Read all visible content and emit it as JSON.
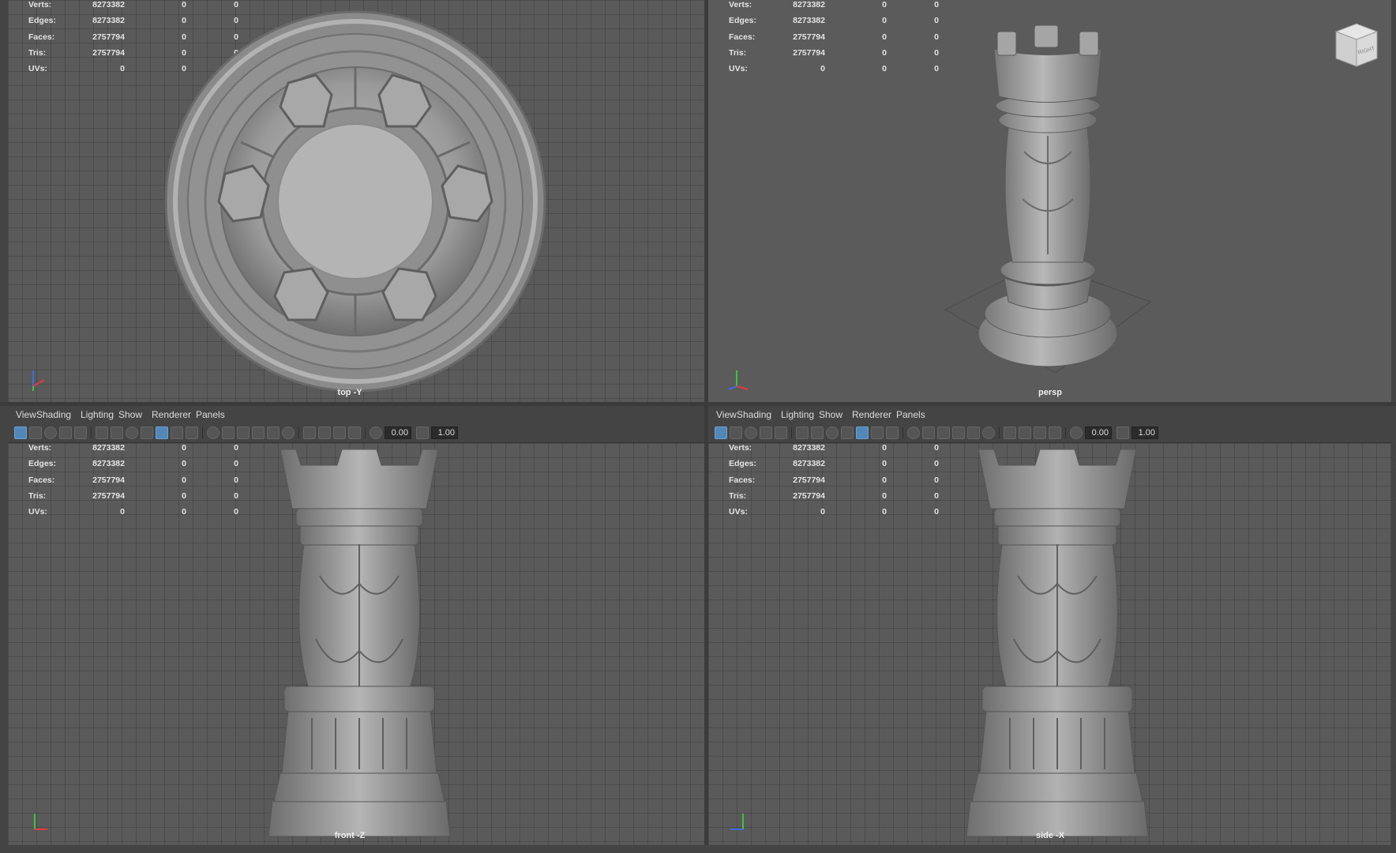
{
  "stats_labels": [
    "Verts:",
    "Edges:",
    "Faces:",
    "Tris:",
    "UVs:"
  ],
  "panels": {
    "top_left": {
      "camera": "top -Y",
      "stats": [
        [
          "8273382",
          "0",
          "0"
        ],
        [
          "8273382",
          "0",
          "0"
        ],
        [
          "2757794",
          "0",
          "0"
        ],
        [
          "2757794",
          "0",
          "0"
        ],
        [
          "0",
          "0",
          "0"
        ]
      ]
    },
    "top_right": {
      "camera": "persp",
      "stats": [
        [
          "8273382",
          "0",
          "0"
        ],
        [
          "8273382",
          "0",
          "0"
        ],
        [
          "2757794",
          "0",
          "0"
        ],
        [
          "2757794",
          "0",
          "0"
        ],
        [
          "0",
          "0",
          "0"
        ]
      ],
      "viewcube_label": "RIGHT"
    },
    "bottom_left": {
      "camera": "front -Z",
      "menu": [
        "View",
        "Shading",
        "Lighting",
        "Show",
        "Renderer",
        "Panels"
      ],
      "toolbar": {
        "field_a": "0.00",
        "field_b": "1.00"
      },
      "stats": [
        [
          "8273382",
          "0",
          "0"
        ],
        [
          "8273382",
          "0",
          "0"
        ],
        [
          "2757794",
          "0",
          "0"
        ],
        [
          "2757794",
          "0",
          "0"
        ],
        [
          "0",
          "0",
          "0"
        ]
      ]
    },
    "bottom_right": {
      "camera": "side -X",
      "menu": [
        "View",
        "Shading",
        "Lighting",
        "Show",
        "Renderer",
        "Panels"
      ],
      "toolbar": {
        "field_a": "0.00",
        "field_b": "1.00"
      },
      "stats": [
        [
          "8273382",
          "0",
          "0"
        ],
        [
          "8273382",
          "0",
          "0"
        ],
        [
          "2757794",
          "0",
          "0"
        ],
        [
          "2757794",
          "0",
          "0"
        ],
        [
          "0",
          "0",
          "0"
        ]
      ]
    }
  },
  "colors": {
    "viewport_bg": "#5a5a5a",
    "toolbar_bg": "#444444",
    "active_icon": "#5287b7",
    "model_gray": "#9a9a9a",
    "axis_x": "#e23b3b",
    "axis_y": "#3ec23e",
    "axis_z": "#3a6ee6"
  },
  "icons": {
    "toolbar": [
      "select-camera-icon",
      "camera-attributes-icon",
      "bookmark-icon",
      "grease-pencil-icon",
      "grid-icon",
      "film-gate-icon",
      "resolution-gate-icon",
      "safe-action-icon",
      "wireframe-icon",
      "smooth-shade-icon",
      "default-material-icon",
      "textured-icon",
      "lights-icon",
      "shadows-icon",
      "ambient-occlusion-icon",
      "motion-blur-icon",
      "anti-aliasing-icon",
      "depth-of-field-icon",
      "isolate-select-icon",
      "xray-icon",
      "xray-joints-icon",
      "backface-culling-icon",
      "exposure-icon",
      "gamma-icon"
    ]
  }
}
